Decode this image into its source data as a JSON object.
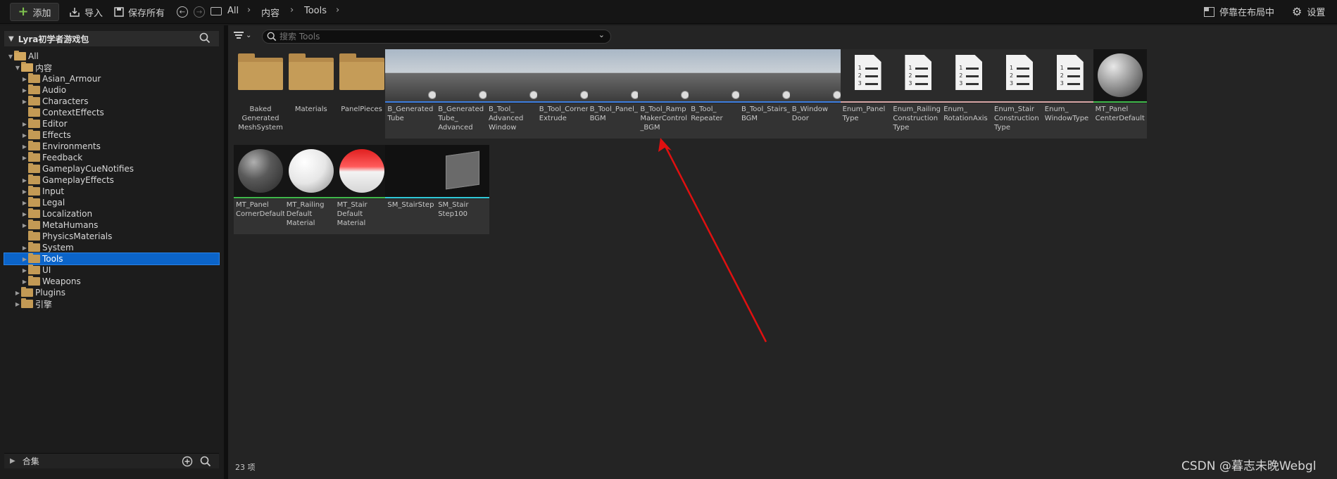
{
  "toolbar": {
    "add_label": "添加",
    "import_label": "导入",
    "save_all_label": "保存所有",
    "breadcrumb": [
      "All",
      "内容",
      "Tools"
    ],
    "dock_label": "停靠在布局中",
    "settings_label": "设置"
  },
  "sources": {
    "title": "Lyra初学者游戏包",
    "tree": [
      {
        "label": "All",
        "depth": 0,
        "expanded": true
      },
      {
        "label": "内容",
        "depth": 1,
        "expanded": true
      },
      {
        "label": "Asian_Armour",
        "depth": 2,
        "arrow": true
      },
      {
        "label": "Audio",
        "depth": 2,
        "arrow": true
      },
      {
        "label": "Characters",
        "depth": 2,
        "arrow": true
      },
      {
        "label": "ContextEffects",
        "depth": 2,
        "arrow": false
      },
      {
        "label": "Editor",
        "depth": 2,
        "arrow": true
      },
      {
        "label": "Effects",
        "depth": 2,
        "arrow": true
      },
      {
        "label": "Environments",
        "depth": 2,
        "arrow": true
      },
      {
        "label": "Feedback",
        "depth": 2,
        "arrow": true
      },
      {
        "label": "GameplayCueNotifies",
        "depth": 2,
        "arrow": false
      },
      {
        "label": "GameplayEffects",
        "depth": 2,
        "arrow": true
      },
      {
        "label": "Input",
        "depth": 2,
        "arrow": true
      },
      {
        "label": "Legal",
        "depth": 2,
        "arrow": true
      },
      {
        "label": "Localization",
        "depth": 2,
        "arrow": true
      },
      {
        "label": "MetaHumans",
        "depth": 2,
        "arrow": true
      },
      {
        "label": "PhysicsMaterials",
        "depth": 2,
        "arrow": false
      },
      {
        "label": "System",
        "depth": 2,
        "arrow": true
      },
      {
        "label": "Tools",
        "depth": 2,
        "arrow": true,
        "selected": true
      },
      {
        "label": "UI",
        "depth": 2,
        "arrow": true
      },
      {
        "label": "Weapons",
        "depth": 2,
        "arrow": true
      },
      {
        "label": "Plugins",
        "depth": 1,
        "arrow": true
      },
      {
        "label": "引擎",
        "depth": 1,
        "arrow": true
      }
    ],
    "collections_label": "合集"
  },
  "content": {
    "search_placeholder": "搜索 Tools",
    "assets": [
      {
        "name": "Baked Generated MeshSystem",
        "kind": "folder"
      },
      {
        "name": "Materials",
        "kind": "folder"
      },
      {
        "name": "PanelPieces",
        "kind": "folder"
      },
      {
        "name": "B_Generated Tube",
        "kind": "blueprint"
      },
      {
        "name": "B_Generated Tube_ Advanced",
        "kind": "blueprint"
      },
      {
        "name": "B_Tool_ Advanced Window",
        "kind": "blueprint"
      },
      {
        "name": "B_Tool_Corner Extrude",
        "kind": "blueprint"
      },
      {
        "name": "B_Tool_Panel_ BGM",
        "kind": "blueprint"
      },
      {
        "name": "B_Tool_Ramp MakerControl _BGM",
        "kind": "blueprint"
      },
      {
        "name": "B_Tool_ Repeater",
        "kind": "blueprint"
      },
      {
        "name": "B_Tool_Stairs_ BGM",
        "kind": "blueprint"
      },
      {
        "name": "B_Window Door",
        "kind": "blueprint"
      },
      {
        "name": "Enum_Panel Type",
        "kind": "enum"
      },
      {
        "name": "Enum_Railing Construction Type",
        "kind": "enum"
      },
      {
        "name": "Enum_ RotationAxis",
        "kind": "enum"
      },
      {
        "name": "Enum_Stair Construction Type",
        "kind": "enum"
      },
      {
        "name": "Enum_ WindowType",
        "kind": "enum"
      },
      {
        "name": "MT_Panel CenterDefault",
        "kind": "material",
        "sphere": "grey"
      },
      {
        "name": "MT_Panel CornerDefault",
        "kind": "material",
        "sphere": "dark"
      },
      {
        "name": "MT_Railing Default Material",
        "kind": "material",
        "sphere": "white"
      },
      {
        "name": "MT_Stair Default Material",
        "kind": "material",
        "sphere": "red"
      },
      {
        "name": "SM_StairStep",
        "kind": "mesh"
      },
      {
        "name": "SM_Stair Step100",
        "kind": "mesh"
      }
    ],
    "item_count": "23 项"
  },
  "watermark": "CSDN @暮志未晚Webgl",
  "colors": {
    "blueprint_bar": "#3d7ee0",
    "enum_bar": "#d8a6a6",
    "material_bar": "#3fb84a",
    "mesh_bar": "#2fc8d8",
    "selection": "#0b64c9",
    "annotation_arrow": "#e01010"
  }
}
